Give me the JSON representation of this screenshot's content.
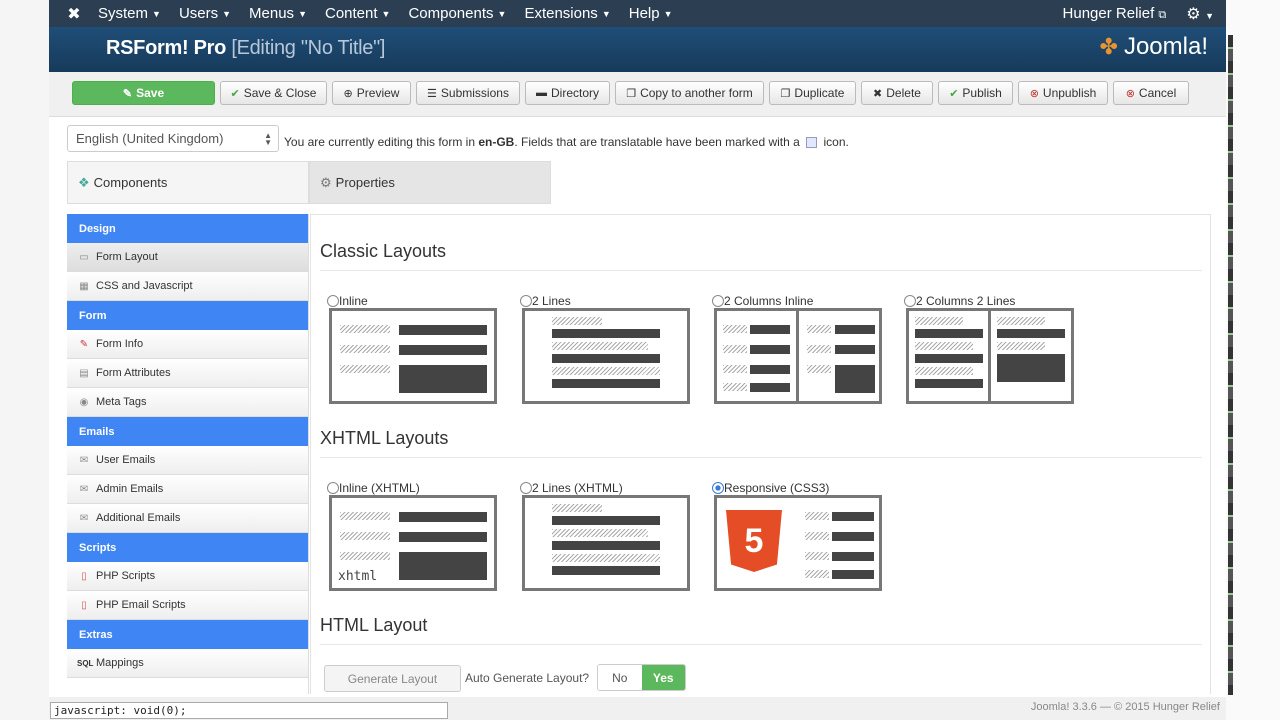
{
  "topnav": {
    "menu": [
      "System",
      "Users",
      "Menus",
      "Content",
      "Components",
      "Extensions",
      "Help"
    ],
    "site": "Hunger Relief"
  },
  "header": {
    "title": "RSForm! Pro",
    "subtitle": "[Editing \"No Title\"]",
    "brand": "Joomla!"
  },
  "toolbar": {
    "save": "Save",
    "save_close": "Save & Close",
    "preview": "Preview",
    "submissions": "Submissions",
    "directory": "Directory",
    "copy": "Copy to another form",
    "duplicate": "Duplicate",
    "delete": "Delete",
    "publish": "Publish",
    "unpublish": "Unpublish",
    "cancel": "Cancel"
  },
  "language": {
    "selected": "English (United Kingdom)"
  },
  "notice": {
    "prefix": "You are currently editing this form in ",
    "lang": "en-GB",
    "suffix": ". Fields that are translatable have been marked with a ",
    "end": " icon."
  },
  "tabs": {
    "components": "Components",
    "properties": "Properties"
  },
  "sidebar": {
    "design": "Design",
    "form_layout": "Form Layout",
    "css_js": "CSS and Javascript",
    "form": "Form",
    "form_info": "Form Info",
    "form_attributes": "Form Attributes",
    "meta_tags": "Meta Tags",
    "emails": "Emails",
    "user_emails": "User Emails",
    "admin_emails": "Admin Emails",
    "additional_emails": "Additional Emails",
    "scripts": "Scripts",
    "php_scripts": "PHP Scripts",
    "php_email_scripts": "PHP Email Scripts",
    "extras": "Extras",
    "mappings": "Mappings"
  },
  "classic": {
    "title": "Classic Layouts",
    "inline": "Inline",
    "two_lines": "2 Lines",
    "two_col_inline": "2 Columns Inline",
    "two_col_two_lines": "2 Columns 2 Lines"
  },
  "xhtml": {
    "title": "XHTML Layouts",
    "inline": "Inline (XHTML)",
    "two_lines": "2 Lines (XHTML)",
    "responsive": "Responsive (CSS3)",
    "xhtml_mark": "xhtml",
    "html5_mark": "5"
  },
  "html_layout": {
    "title": "HTML Layout",
    "generate": "Generate Layout",
    "auto_label": "Auto Generate Layout?",
    "no": "No",
    "yes": "Yes"
  },
  "footer": {
    "text": "Joomla! 3.3.6  —  © 2015 Hunger Relief"
  },
  "status": {
    "text": "javascript: void(0);"
  },
  "colors": {
    "nav": "#2c3e52",
    "header": "#1f4e78",
    "accent": "#3f85f4",
    "success": "#5cb85c"
  }
}
